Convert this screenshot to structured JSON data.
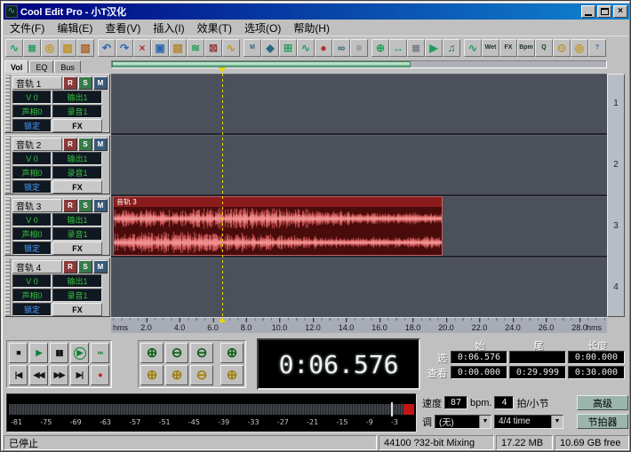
{
  "window": {
    "title": "Cool Edit Pro - 小T汉化"
  },
  "menu_bar": {
    "items": [
      "文件(F)",
      "编辑(E)",
      "查看(V)",
      "插入(I)",
      "效果(T)",
      "选项(O)",
      "帮助(H)"
    ]
  },
  "toolbar": {
    "groups": [
      [
        {
          "name": "edit-waveform-view-icon",
          "glyph": "∿",
          "color": "#1e9e5a"
        },
        {
          "name": "multitrack-view-icon",
          "glyph": "≣",
          "color": "#1e9e5a"
        },
        {
          "name": "cd-project-view-icon",
          "glyph": "◎",
          "color": "#c09020"
        },
        {
          "name": "open-file-icon",
          "glyph": "▨",
          "color": "#c09020"
        },
        {
          "name": "save-file-icon",
          "glyph": "▧",
          "color": "#b06020"
        }
      ],
      [
        {
          "name": "undo-icon",
          "glyph": "↶",
          "color": "#2a66b0"
        },
        {
          "name": "redo-icon",
          "glyph": "↷",
          "color": "#2a66b0"
        },
        {
          "name": "cut-icon",
          "glyph": "×",
          "color": "#b03030"
        },
        {
          "name": "copy-icon",
          "glyph": "▣",
          "color": "#2a66b0"
        },
        {
          "name": "paste-icon",
          "glyph": "▤",
          "color": "#b08020"
        },
        {
          "name": "mix-paste-icon",
          "glyph": "≋",
          "color": "#1e9e5a"
        },
        {
          "name": "delete-clip-icon",
          "glyph": "⊠",
          "color": "#904040"
        },
        {
          "name": "crossfade-icon",
          "glyph": "∿",
          "color": "#c09020"
        }
      ],
      [
        {
          "name": "mute-clip-icon",
          "glyph": "M",
          "color": "#2a6680",
          "text": true
        },
        {
          "name": "lock-time-icon",
          "glyph": "◆",
          "color": "#2a6680"
        },
        {
          "name": "group-clips-icon",
          "glyph": "⊞",
          "color": "#1e9e5a"
        },
        {
          "name": "clip-envelope-icon",
          "glyph": "∿",
          "color": "#1e9e5a"
        },
        {
          "name": "punch-in-icon",
          "glyph": "●",
          "color": "#b03030"
        },
        {
          "name": "loop-duplicate-icon",
          "glyph": "∞",
          "color": "#2a6680"
        },
        {
          "name": "clip-properties-icon",
          "glyph": "≡",
          "color": "#707880"
        }
      ],
      [
        {
          "name": "zoom-tool-icon",
          "glyph": "⊕",
          "color": "#1e9e5a"
        },
        {
          "name": "scroll-view-icon",
          "glyph": "↔",
          "color": "#1e9e5a"
        },
        {
          "name": "cue-list-icon",
          "glyph": "≣",
          "color": "#707880"
        },
        {
          "name": "play-list-icon",
          "glyph": "▶",
          "color": "#1e9e5a"
        },
        {
          "name": "mixer-icon",
          "glyph": "♫",
          "color": "#2a6680"
        }
      ],
      [
        {
          "name": "av-meter-icon",
          "glyph": "∿",
          "color": "#1e9e5a"
        },
        {
          "name": "wet-dry-icon",
          "glyph": "Wet",
          "color": "#203030",
          "text": true
        },
        {
          "name": "fx-rack-icon",
          "glyph": "FX",
          "color": "#203030",
          "text": true
        },
        {
          "name": "bpm-icon",
          "glyph": "Bpm",
          "color": "#203030",
          "text": true
        },
        {
          "name": "quantize-icon",
          "glyph": "Q",
          "color": "#203030",
          "text": true
        },
        {
          "name": "clock-icon",
          "glyph": "⊙",
          "color": "#c09020"
        },
        {
          "name": "cd-burn-icon",
          "glyph": "◎",
          "color": "#c09020"
        },
        {
          "name": "help-icon",
          "glyph": "?",
          "color": "#2a66b0",
          "text": true
        }
      ]
    ]
  },
  "left_panel": {
    "tabs": [
      {
        "label": "Vol",
        "active": true
      },
      {
        "label": "EQ",
        "active": false
      },
      {
        "label": "Bus",
        "active": false
      }
    ],
    "tracks": [
      {
        "name": "音轨 1"
      },
      {
        "name": "音轨 2"
      },
      {
        "name": "音轨 3"
      },
      {
        "name": "音轨 4"
      }
    ],
    "controls": {
      "record": "R",
      "solo": "S",
      "mute": "M",
      "volume": "V 0",
      "out": "输出1",
      "pan": "声相0",
      "rec_device": "录音1",
      "lock": "锁定",
      "fx": "FX"
    }
  },
  "track_view": {
    "clip": {
      "label": "音轨 3",
      "start_sec": 0,
      "end_sec": 19.8,
      "track": 3
    },
    "playhead_sec": 6.576,
    "track_numbers": [
      "1",
      "2",
      "3",
      "4"
    ]
  },
  "timeline": {
    "unit_left": "hms",
    "unit_right": "hms",
    "ticks": [
      "2.0",
      "4.0",
      "6.0",
      "8.0",
      "10.0",
      "12.0",
      "14.0",
      "16.0",
      "18.0",
      "20.0",
      "22.0",
      "24.0",
      "26.0",
      "28.0"
    ]
  },
  "transport": {
    "rows": [
      [
        {
          "name": "stop-button",
          "glyph": "■",
          "color": "#151515"
        },
        {
          "name": "play-button",
          "glyph": "▶",
          "color": "#0e7f30"
        },
        {
          "name": "pause-button",
          "glyph": "▮▮",
          "color": "#151515"
        },
        {
          "name": "play-looped-button",
          "glyph": "▶",
          "color": "#0e7f30",
          "circled": true
        },
        {
          "name": "loop-button",
          "glyph": "∞",
          "color": "#0e7f30"
        }
      ],
      [
        {
          "name": "go-to-start-button",
          "glyph": "|◀",
          "color": "#151515"
        },
        {
          "name": "rewind-button",
          "glyph": "◀◀",
          "color": "#151515"
        },
        {
          "name": "fast-forward-button",
          "glyph": "▶▶",
          "color": "#151515"
        },
        {
          "name": "go-to-end-button",
          "glyph": "▶|",
          "color": "#151515"
        },
        {
          "name": "record-button",
          "glyph": "●",
          "color": "#c02020"
        }
      ]
    ]
  },
  "zoom": {
    "rows": [
      [
        {
          "name": "zoom-in-button",
          "glyph": "⊕",
          "color": "#14601f"
        },
        {
          "name": "zoom-out-button",
          "glyph": "⊖",
          "color": "#14601f"
        },
        {
          "name": "zoom-full-button",
          "glyph": "⊖",
          "color": "#14601f"
        },
        {
          "name": "zoom-to-selection-button",
          "glyph": "⊕",
          "color": "#14601f",
          "gap": true
        }
      ],
      [
        {
          "name": "zoom-sel-left-button",
          "glyph": "⊕",
          "color": "#a08010"
        },
        {
          "name": "zoom-sel-right-button",
          "glyph": "⊕",
          "color": "#a08010"
        },
        {
          "name": "zoom-out-all-button",
          "glyph": "⊖",
          "color": "#a08010"
        },
        {
          "name": "zoom-vertical-button",
          "glyph": "⊕",
          "color": "#a08010",
          "gap": true
        }
      ]
    ]
  },
  "time_display": {
    "value": "0:06.576"
  },
  "selection_table": {
    "headers": [
      "始",
      "尾",
      "长度"
    ],
    "rows": [
      {
        "label": "选",
        "values": [
          "0:06.576",
          "",
          "0:00.000"
        ]
      },
      {
        "label": "查看",
        "values": [
          "0:00.000",
          "0:29.999",
          "0:30.000"
        ]
      }
    ]
  },
  "session": {
    "tempo_label": "速度",
    "tempo_value": "87",
    "tempo_unit": "bpm.",
    "beats_value": "4",
    "beats_unit": "拍/小节",
    "advanced_button": "高级",
    "key_label": "调",
    "key_value": "(无)",
    "time_sig_value": "4/4 time",
    "metronome_button": "节拍器"
  },
  "meter": {
    "labels": [
      "-81",
      "-75",
      "-69",
      "-63",
      "-57",
      "-51",
      "-45",
      "-39",
      "-33",
      "-27",
      "-21",
      "-15",
      "-9",
      "-3"
    ]
  },
  "status_bar": {
    "state": "已停止",
    "format": "44100 ?32-bit Mixing",
    "memory": "17.22 MB",
    "free": "10.69 GB free"
  }
}
